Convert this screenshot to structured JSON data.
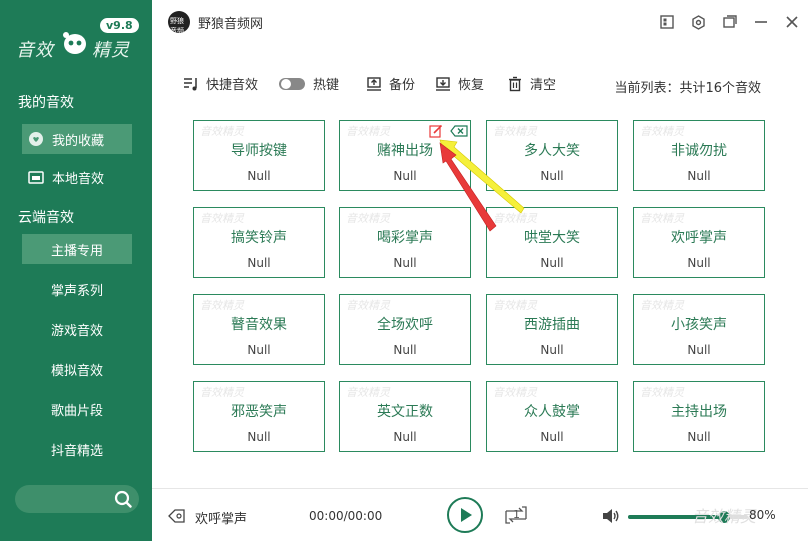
{
  "app": {
    "logo_text_left": "音效",
    "logo_text_right": "精灵",
    "version": "v9.8",
    "title": "野狼音频网",
    "avatar_text": "野狼音频"
  },
  "sidebar": {
    "section_my": "我的音效",
    "favorites": "我的收藏",
    "local": "本地音效",
    "section_cloud": "云端音效",
    "cloud_items": [
      "主播专用",
      "掌声系列",
      "游戏音效",
      "模拟音效",
      "歌曲片段",
      "抖音精选"
    ],
    "active_cloud_index": 0
  },
  "toolbar": {
    "hotkey_sound": "快捷音效",
    "hotkey": "热键",
    "backup": "备份",
    "restore": "恢复",
    "clear": "清空",
    "list_info": "当前列表：共计16个音效"
  },
  "cards": [
    {
      "name": "导师按键",
      "key": "Null"
    },
    {
      "name": "赌神出场",
      "key": "Null"
    },
    {
      "name": "多人大笑",
      "key": "Null"
    },
    {
      "name": "非诚勿扰",
      "key": "Null"
    },
    {
      "name": "搞笑铃声",
      "key": "Null"
    },
    {
      "name": "喝彩掌声",
      "key": "Null"
    },
    {
      "name": "哄堂大笑",
      "key": "Null"
    },
    {
      "name": "欢呼掌声",
      "key": "Null"
    },
    {
      "name": "瞽音效果",
      "key": "Null"
    },
    {
      "name": "全场欢呼",
      "key": "Null"
    },
    {
      "name": "西游插曲",
      "key": "Null"
    },
    {
      "name": "小孩笑声",
      "key": "Null"
    },
    {
      "name": "邪恶笑声",
      "key": "Null"
    },
    {
      "name": "英文正数",
      "key": "Null"
    },
    {
      "name": "众人鼓掌",
      "key": "Null"
    },
    {
      "name": "主持出场",
      "key": "Null"
    }
  ],
  "card_watermark": "音效精灵",
  "player": {
    "track": "欢呼掌声",
    "time": "00:00/00:00",
    "loop_label": "1",
    "volume": 80,
    "volume_label": "80%",
    "watermark": "音效精灵"
  },
  "colors": {
    "sidebar": "#1e7b57",
    "active": "#4b9a76",
    "card_border": "#2b8a5f",
    "annotation_red": "#e83a3a",
    "annotation_yellow": "#f5f03a"
  }
}
